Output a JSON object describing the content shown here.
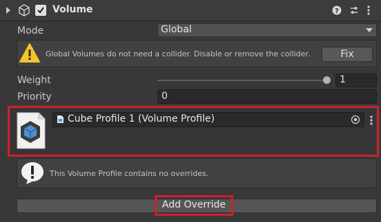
{
  "header": {
    "title": "Volume",
    "enabled": true
  },
  "mode": {
    "label": "Mode",
    "value": "Global"
  },
  "collider_warning": {
    "text": "Global Volumes do not need a collider. Disable or remove the collider.",
    "fix_label": "Fix"
  },
  "weight": {
    "label": "Weight",
    "value": "1",
    "level": 1.0
  },
  "priority": {
    "label": "Priority",
    "value": "0"
  },
  "profile": {
    "value": "Cube Profile 1 (Volume Profile)"
  },
  "no_override_info": {
    "text": "This Volume Profile contains no overrides."
  },
  "add_override": {
    "label": "Add Override"
  },
  "colors": {
    "highlight": "#d0202a",
    "warning": "#f3c42c"
  },
  "icons": [
    "fold-arrow-icon",
    "volume-component-icon",
    "checkbox-icon",
    "help-icon",
    "presets-icon",
    "more-options-icon",
    "warning-icon",
    "info-icon",
    "volume-profile-asset-icon",
    "object-picker-icon"
  ]
}
